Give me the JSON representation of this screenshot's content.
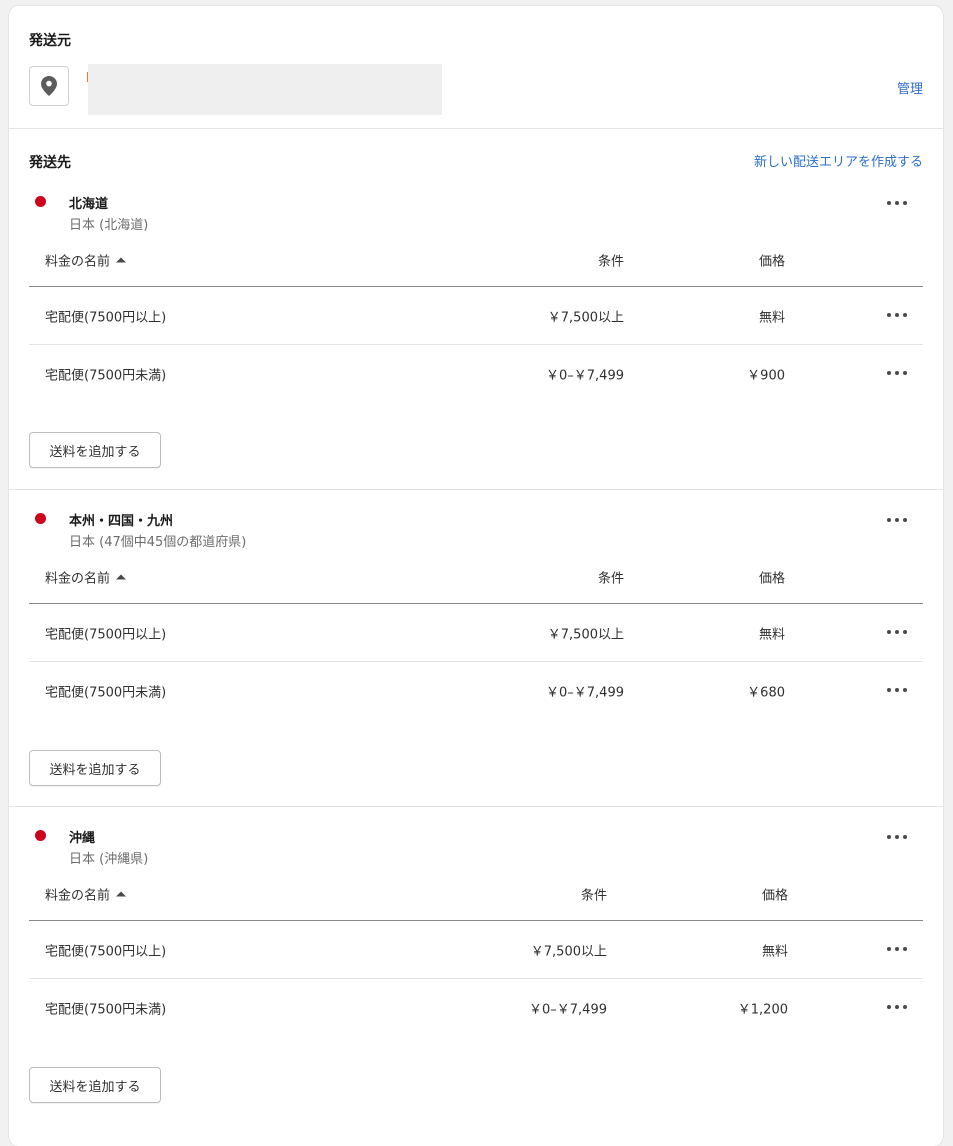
{
  "origin": {
    "title": "発送元",
    "manage_link": "管理",
    "icon": "map-pin-icon"
  },
  "destination": {
    "title": "発送先",
    "create_link": "新しい配送エリアを作成する"
  },
  "table_headers": {
    "name": "料金の名前",
    "condition": "条件",
    "price": "価格"
  },
  "add_button_label": "送料を追加する",
  "accent_color": "#2c6ecb",
  "zone_dot_color": "#d0021b",
  "zones": [
    {
      "name": "北海道",
      "sub": "日本 (北海道)",
      "rates": [
        {
          "name": "宅配便(7500円以上)",
          "condition": "￥7,500以上",
          "price": "無料"
        },
        {
          "name": "宅配便(7500円未満)",
          "condition": "￥0–￥7,499",
          "price": "￥900"
        }
      ]
    },
    {
      "name": "本州・四国・九州",
      "sub": "日本 (47個中45個の都道府県)",
      "rates": [
        {
          "name": "宅配便(7500円以上)",
          "condition": "￥7,500以上",
          "price": "無料"
        },
        {
          "name": "宅配便(7500円未満)",
          "condition": "￥0–￥7,499",
          "price": "￥680"
        }
      ]
    },
    {
      "name": "沖縄",
      "sub": "日本 (沖縄県)",
      "rates": [
        {
          "name": "宅配便(7500円以上)",
          "condition": "￥7,500以上",
          "price": "無料"
        },
        {
          "name": "宅配便(7500円未満)",
          "condition": "￥0–￥7,499",
          "price": "￥1,200"
        }
      ]
    }
  ]
}
